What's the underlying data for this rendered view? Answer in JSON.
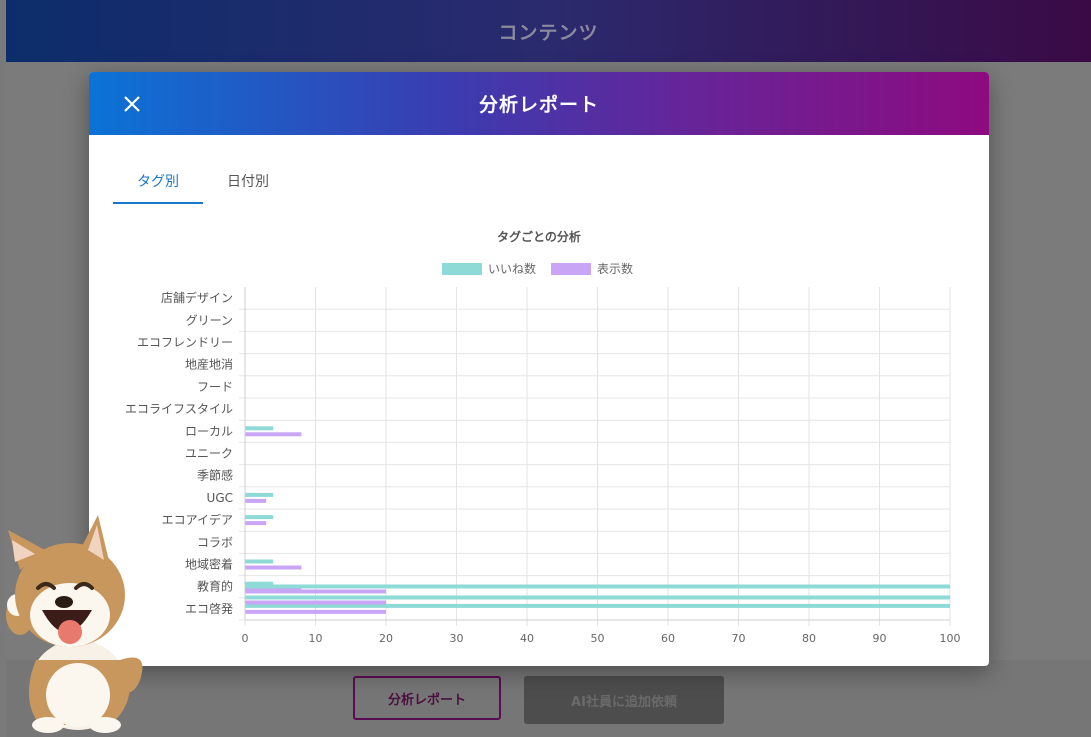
{
  "topbar": {
    "title": "コンテンツ"
  },
  "modal": {
    "title": "分析レポート",
    "tabs": [
      {
        "label": "タグ別",
        "active": true
      },
      {
        "label": "日付別",
        "active": false
      }
    ]
  },
  "footer": {
    "report_button": "分析レポート",
    "ai_button": "AI社員に追加依頼"
  },
  "colors": {
    "likes": "#8edad6",
    "views": "#c8a6f5",
    "header_start": "#0b73d6",
    "header_end": "#8e0a80"
  },
  "chart_data": {
    "type": "bar",
    "orientation": "horizontal",
    "title": "タグごとの分析",
    "legend_position": "top",
    "categories": [
      "店舗デザイン",
      "グリーン",
      "エコフレンドリー",
      "地産地消",
      "フード",
      "エコライフスタイル",
      "ローカル",
      "ユニーク",
      "季節感",
      "UGC",
      "エコアイデア",
      "コラボ",
      "地域密着",
      "教育的",
      "エコ啓発"
    ],
    "xlim": [
      0,
      100
    ],
    "xticks": [
      0,
      10,
      20,
      30,
      40,
      50,
      60,
      70,
      80,
      90,
      100
    ],
    "grid": true,
    "series": [
      {
        "name": "いいね数",
        "color": "#8edad6",
        "values": [
          0,
          0,
          0,
          0,
          0,
          0,
          4,
          0,
          0,
          4,
          4,
          0,
          4,
          4,
          100
        ]
      },
      {
        "name": "表示数",
        "color": "#c8a6f5",
        "values": [
          0,
          0,
          0,
          0,
          0,
          0,
          8,
          0,
          0,
          3,
          3,
          0,
          8,
          8,
          20
        ]
      }
    ],
    "extra_bars_in_last_category": {
      "likes": [
        100,
        100
      ],
      "views": [
        20,
        20
      ]
    }
  }
}
